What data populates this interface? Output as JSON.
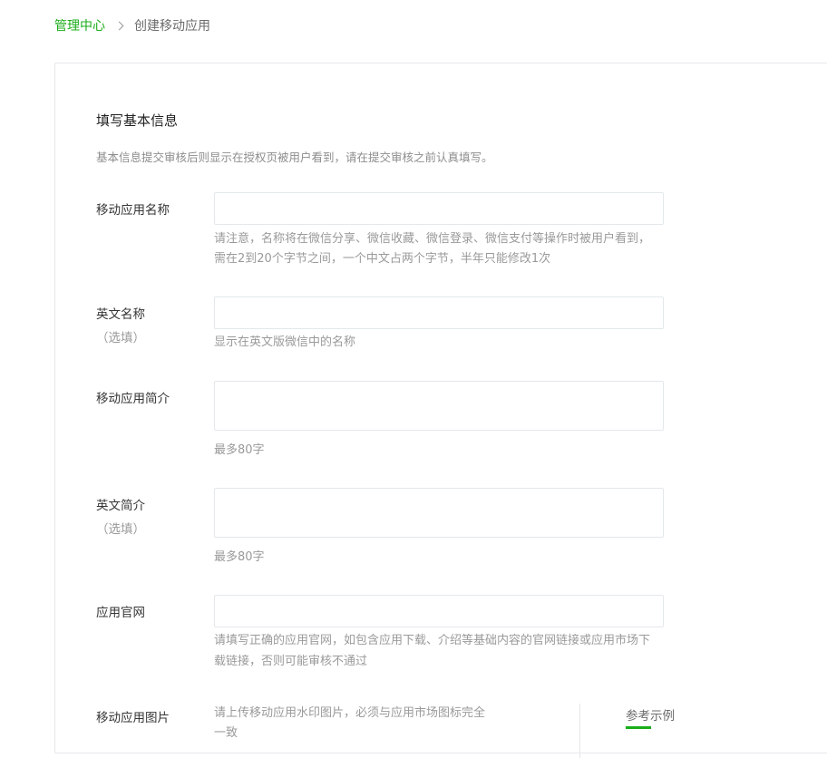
{
  "breadcrumb": {
    "home": "管理中心",
    "current": "创建移动应用"
  },
  "section": {
    "title": "填写基本信息",
    "description": "基本信息提交审核后则显示在授权页被用户看到，请在提交审核之前认真填写。"
  },
  "fields": {
    "app_name": {
      "label": "移动应用名称",
      "value": "",
      "tip_line1": "请注意，名称将在微信分享、微信收藏、微信登录、微信支付等操作时被用户看到，",
      "tip_line2": "需在2到20个字节之间，一个中文占两个字节，半年只能修改1次"
    },
    "english_name": {
      "label": "英文名称",
      "optional": "（选填）",
      "value": "",
      "tip": "显示在英文版微信中的名称"
    },
    "app_intro": {
      "label": "移动应用简介",
      "value": "",
      "tip": "最多80字"
    },
    "english_intro": {
      "label": "英文简介",
      "optional": "（选填）",
      "value": "",
      "tip": "最多80字"
    },
    "website": {
      "label": "应用官网",
      "value": "",
      "tip_line1": "请填写正确的应用官网，如包含应用下载、介绍等基础内容的官网链接或应用市场下",
      "tip_line2": "载链接，否则可能审核不通过"
    },
    "app_image": {
      "label": "移动应用图片",
      "tip_line1": "请上传移动应用水印图片，必须与应用市场图标完全",
      "tip_line2": "一致"
    }
  },
  "reference": {
    "tab_label": "参考示例"
  },
  "colors": {
    "accent": "#1aad19",
    "border": "#e4e8eb",
    "tip_text": "#9a9a9a"
  }
}
